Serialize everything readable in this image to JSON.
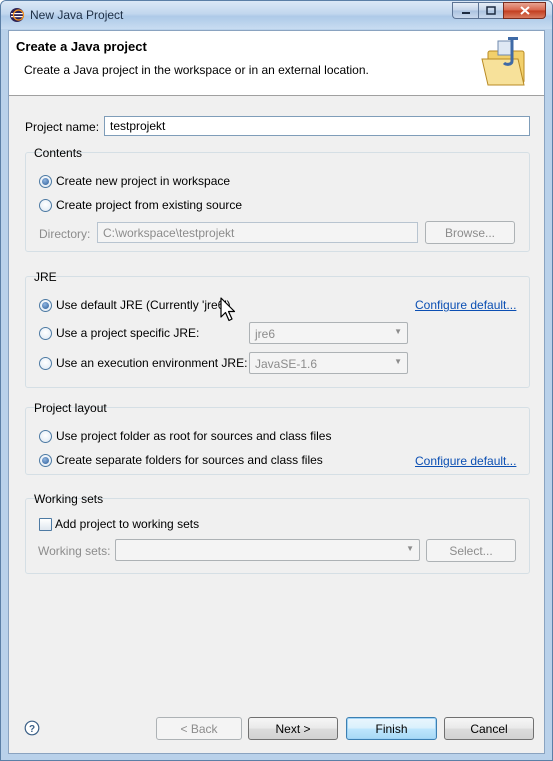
{
  "window": {
    "title": "New Java Project",
    "icon": "eclipse-app-icon",
    "controls": [
      "minimize-icon",
      "maximize-icon",
      "close-icon"
    ]
  },
  "header": {
    "title": "Create a Java project",
    "description": "Create a Java project in the workspace or in an external location.",
    "banner_icon": "java-project-folder-icon"
  },
  "project_name": {
    "label": "Project name:",
    "value": "testprojekt"
  },
  "contents": {
    "group_label": "Contents",
    "option_workspace": "Create new project in workspace",
    "option_existing": "Create project from existing source",
    "selected": "workspace",
    "directory_label": "Directory:",
    "directory_value": "C:\\workspace\\testprojekt",
    "browse_label": "Browse..."
  },
  "jre": {
    "group_label": "JRE",
    "option_default": "Use default JRE (Currently 'jre6')",
    "configure_link": "Configure default...",
    "option_specific": "Use a project specific JRE:",
    "specific_value": "jre6",
    "option_env": "Use an execution environment JRE:",
    "env_value": "JavaSE-1.6",
    "selected": "default"
  },
  "project_layout": {
    "group_label": "Project layout",
    "option_root": "Use project folder as root for sources and class files",
    "option_separate": "Create separate folders for sources and class files",
    "configure_link": "Configure default...",
    "selected": "separate"
  },
  "working_sets": {
    "group_label": "Working sets",
    "checkbox_label": "Add project to working sets",
    "checked": false,
    "sets_label": "Working sets:",
    "sets_value": "",
    "select_label": "Select..."
  },
  "footer": {
    "help_icon": "help-icon",
    "back_label": "< Back",
    "next_label": "Next >",
    "finish_label": "Finish",
    "cancel_label": "Cancel"
  }
}
